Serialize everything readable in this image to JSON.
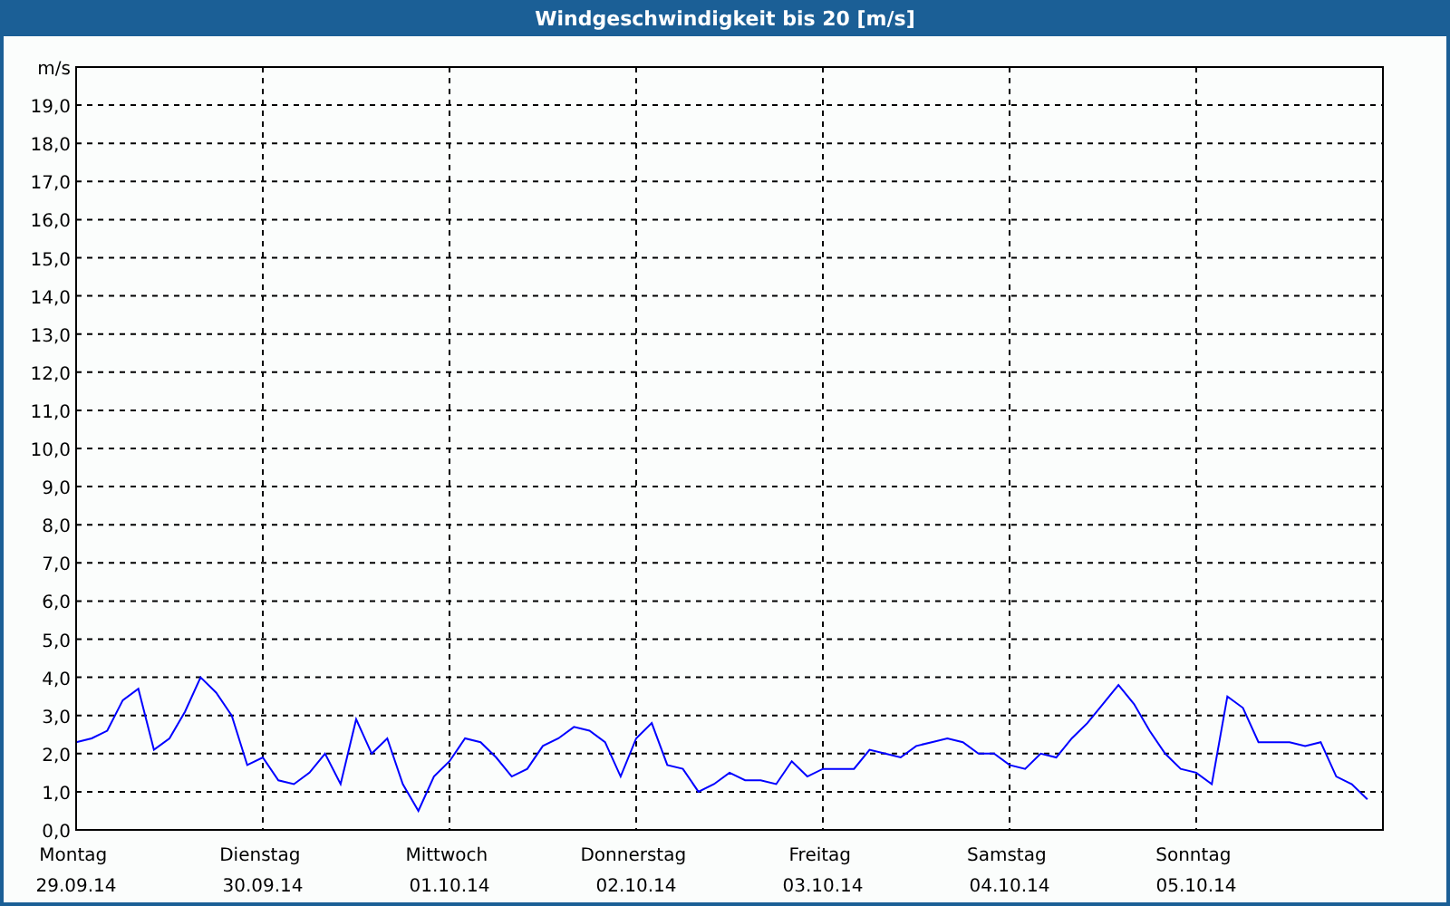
{
  "window": {
    "title": "Windgeschwindigkeit bis 20 [m/s]"
  },
  "chart": {
    "chart_data": {
      "type": "line",
      "grid": true,
      "ylabel": "m/s",
      "ylim": [
        0,
        20
      ],
      "yticks": [
        {
          "value": 0,
          "label": "0,0"
        },
        {
          "value": 1,
          "label": "1,0"
        },
        {
          "value": 2,
          "label": "2,0"
        },
        {
          "value": 3,
          "label": "3,0"
        },
        {
          "value": 4,
          "label": "4,0"
        },
        {
          "value": 5,
          "label": "5,0"
        },
        {
          "value": 6,
          "label": "6,0"
        },
        {
          "value": 7,
          "label": "7,0"
        },
        {
          "value": 8,
          "label": "8,0"
        },
        {
          "value": 9,
          "label": "9,0"
        },
        {
          "value": 10,
          "label": "10,0"
        },
        {
          "value": 11,
          "label": "11,0"
        },
        {
          "value": 12,
          "label": "12,0"
        },
        {
          "value": 13,
          "label": "13,0"
        },
        {
          "value": 14,
          "label": "14,0"
        },
        {
          "value": 15,
          "label": "15,0"
        },
        {
          "value": 16,
          "label": "16,0"
        },
        {
          "value": 17,
          "label": "17,0"
        },
        {
          "value": 18,
          "label": "18,0"
        },
        {
          "value": 19,
          "label": "19,0"
        }
      ],
      "categories": [
        "Montag\n29.09.14",
        null,
        null,
        null,
        null,
        null,
        null,
        null,
        null,
        null,
        null,
        null,
        "Dienstag\n30.09.14",
        null,
        null,
        null,
        null,
        null,
        null,
        null,
        null,
        null,
        null,
        null,
        "Mittwoch\n01.10.14",
        null,
        null,
        null,
        null,
        null,
        null,
        null,
        null,
        null,
        null,
        null,
        "Donnerstag\n02.10.14",
        null,
        null,
        null,
        null,
        null,
        null,
        null,
        null,
        null,
        null,
        null,
        "Freitag\n03.10.14",
        null,
        null,
        null,
        null,
        null,
        null,
        null,
        null,
        null,
        null,
        null,
        "Samstag\n04.10.14",
        null,
        null,
        null,
        null,
        null,
        null,
        null,
        null,
        null,
        null,
        null,
        "Sonntag\n05.10.14",
        null,
        null,
        null,
        null,
        null,
        null,
        null,
        null,
        null,
        null,
        null
      ],
      "series": [
        {
          "color": "#0000ff",
          "values": [
            2.3,
            2.4,
            2.6,
            3.4,
            3.7,
            2.1,
            2.4,
            3.1,
            4.0,
            3.6,
            3.0,
            1.7,
            1.9,
            1.3,
            1.2,
            1.5,
            2.0,
            1.2,
            2.9,
            2.0,
            2.4,
            1.2,
            0.5,
            1.4,
            1.8,
            2.4,
            2.3,
            1.9,
            1.4,
            1.6,
            2.2,
            2.4,
            2.7,
            2.6,
            2.3,
            1.4,
            2.4,
            2.8,
            1.7,
            1.6,
            1.0,
            1.2,
            1.5,
            1.3,
            1.3,
            1.2,
            1.8,
            1.4,
            1.6,
            1.6,
            1.6,
            2.1,
            2.0,
            1.9,
            2.2,
            2.3,
            2.4,
            2.3,
            2.0,
            2.0,
            1.7,
            1.6,
            2.0,
            1.9,
            2.4,
            2.8,
            3.3,
            3.8,
            3.3,
            2.6,
            2.0,
            1.6,
            1.5,
            1.2,
            3.5,
            3.2,
            2.3,
            2.3,
            2.3,
            2.2,
            2.3,
            1.4,
            1.2,
            0.8
          ]
        }
      ]
    }
  }
}
